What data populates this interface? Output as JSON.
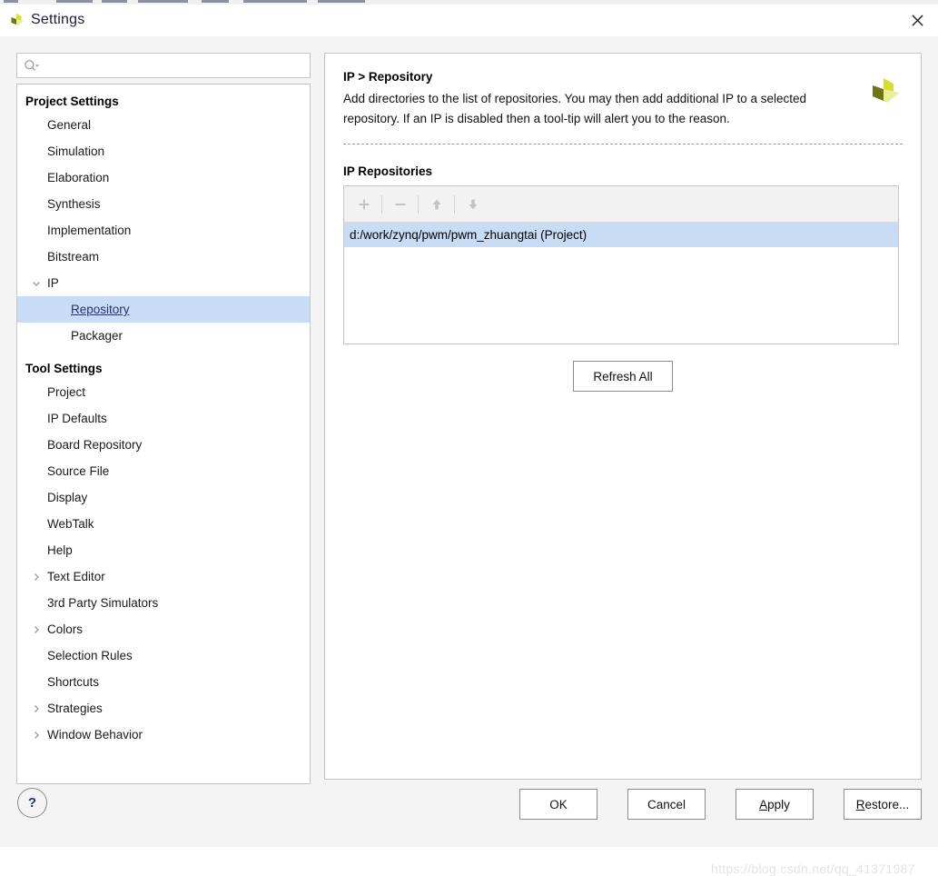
{
  "window": {
    "title": "Settings",
    "app_icon": "xilinx-logo-icon",
    "close_label": "✕"
  },
  "colors": {
    "selection_blue": "#c9dcf5",
    "dialog_bg": "#f4f4f4",
    "panel_bg": "#ffffff",
    "border": "#c4c4c4",
    "link_text": "#23346b",
    "logo_dark_olive": "#6f7414",
    "logo_yellow": "#d6e02a",
    "logo_pale": "#e8ef96",
    "watermark_grey": "#e3e3e3"
  },
  "search": {
    "value": "",
    "placeholder": "",
    "icon": "search-icon"
  },
  "sidebar": {
    "groups": [
      {
        "label": "Project Settings",
        "items": [
          {
            "label": "General",
            "indent": 1,
            "expander": "none",
            "selected": false
          },
          {
            "label": "Simulation",
            "indent": 1,
            "expander": "none",
            "selected": false
          },
          {
            "label": "Elaboration",
            "indent": 1,
            "expander": "none",
            "selected": false
          },
          {
            "label": "Synthesis",
            "indent": 1,
            "expander": "none",
            "selected": false
          },
          {
            "label": "Implementation",
            "indent": 1,
            "expander": "none",
            "selected": false
          },
          {
            "label": "Bitstream",
            "indent": 1,
            "expander": "none",
            "selected": false
          },
          {
            "label": "IP",
            "indent": 1,
            "expander": "expanded",
            "selected": false
          },
          {
            "label": "Repository",
            "indent": 2,
            "expander": "none",
            "selected": true
          },
          {
            "label": "Packager",
            "indent": 2,
            "expander": "none",
            "selected": false
          }
        ]
      },
      {
        "label": "Tool Settings",
        "items": [
          {
            "label": "Project",
            "indent": 1,
            "expander": "none",
            "selected": false
          },
          {
            "label": "IP Defaults",
            "indent": 1,
            "expander": "none",
            "selected": false
          },
          {
            "label": "Board Repository",
            "indent": 1,
            "expander": "none",
            "selected": false
          },
          {
            "label": "Source File",
            "indent": 1,
            "expander": "none",
            "selected": false
          },
          {
            "label": "Display",
            "indent": 1,
            "expander": "none",
            "selected": false
          },
          {
            "label": "WebTalk",
            "indent": 1,
            "expander": "none",
            "selected": false
          },
          {
            "label": "Help",
            "indent": 1,
            "expander": "none",
            "selected": false
          },
          {
            "label": "Text Editor",
            "indent": 1,
            "expander": "collapsed",
            "selected": false
          },
          {
            "label": "3rd Party Simulators",
            "indent": 1,
            "expander": "none",
            "selected": false
          },
          {
            "label": "Colors",
            "indent": 1,
            "expander": "collapsed",
            "selected": false
          },
          {
            "label": "Selection Rules",
            "indent": 1,
            "expander": "none",
            "selected": false
          },
          {
            "label": "Shortcuts",
            "indent": 1,
            "expander": "none",
            "selected": false
          },
          {
            "label": "Strategies",
            "indent": 1,
            "expander": "collapsed",
            "selected": false
          },
          {
            "label": "Window Behavior",
            "indent": 1,
            "expander": "collapsed",
            "selected": false
          }
        ]
      }
    ]
  },
  "panel": {
    "breadcrumb_title": "IP > Repository",
    "description": "Add directories to the list of repositories. You may then add additional IP to a selected repository. If an IP is disabled then a tool-tip will alert you to the reason.",
    "logo_icon": "xilinx-logo-icon",
    "section_label": "IP Repositories",
    "toolbar": [
      {
        "name": "add-repository-button",
        "glyph": "+",
        "enabled": false
      },
      {
        "name": "remove-repository-button",
        "glyph": "−",
        "enabled": false
      },
      {
        "name": "move-repository-up-button",
        "glyph": "↑",
        "enabled": false
      },
      {
        "name": "move-repository-down-button",
        "glyph": "↓",
        "enabled": false
      }
    ],
    "repositories": [
      {
        "path": "d:/work/zynq/pwm/pwm_zhuangtai (Project)",
        "selected": true
      }
    ],
    "refresh_label": "Refresh All"
  },
  "footer": {
    "help_label": "?",
    "buttons": [
      {
        "label": "OK",
        "mnemonic": "",
        "name": "ok-button"
      },
      {
        "label": "Cancel",
        "mnemonic": "",
        "name": "cancel-button"
      },
      {
        "label": "Apply",
        "mnemonic": "A",
        "name": "apply-button"
      },
      {
        "label": "Restore...",
        "mnemonic": "R",
        "name": "restore-button"
      }
    ]
  },
  "watermark": "https://blog.csdn.net/qq_41371987"
}
